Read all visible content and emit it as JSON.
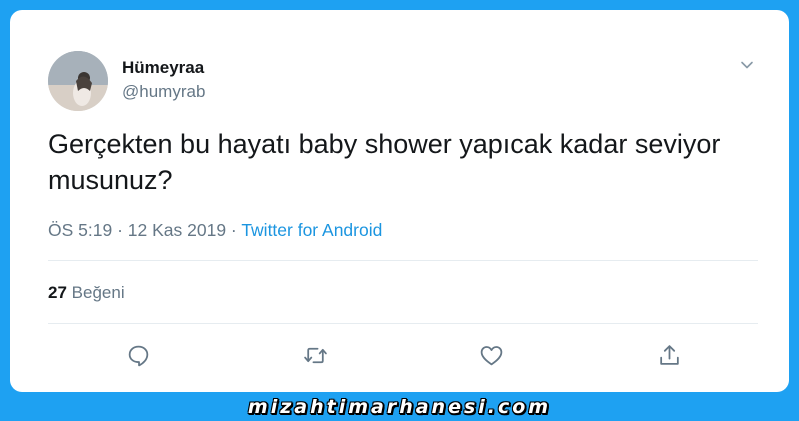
{
  "tweet": {
    "author_name": "Hümeyraa",
    "author_handle": "@humyrab",
    "text": "Gerçekten bu hayatı baby shower yapıcak kadar seviyor musunuz?",
    "time": "ÖS 5:19",
    "separator": " · ",
    "date": "12 Kas 2019",
    "source": "Twitter for Android",
    "like_count": "27",
    "like_label": "Beğeni"
  },
  "icons": {
    "menu": "chevron-down-icon",
    "reply": "reply-icon",
    "retweet": "retweet-icon",
    "like": "heart-icon",
    "share": "share-icon"
  },
  "colors": {
    "background": "#1ea1f2",
    "text_primary": "#14171a",
    "text_secondary": "#657786",
    "link": "#1b95e0"
  },
  "watermark": "mizahtimarhanesi.com"
}
